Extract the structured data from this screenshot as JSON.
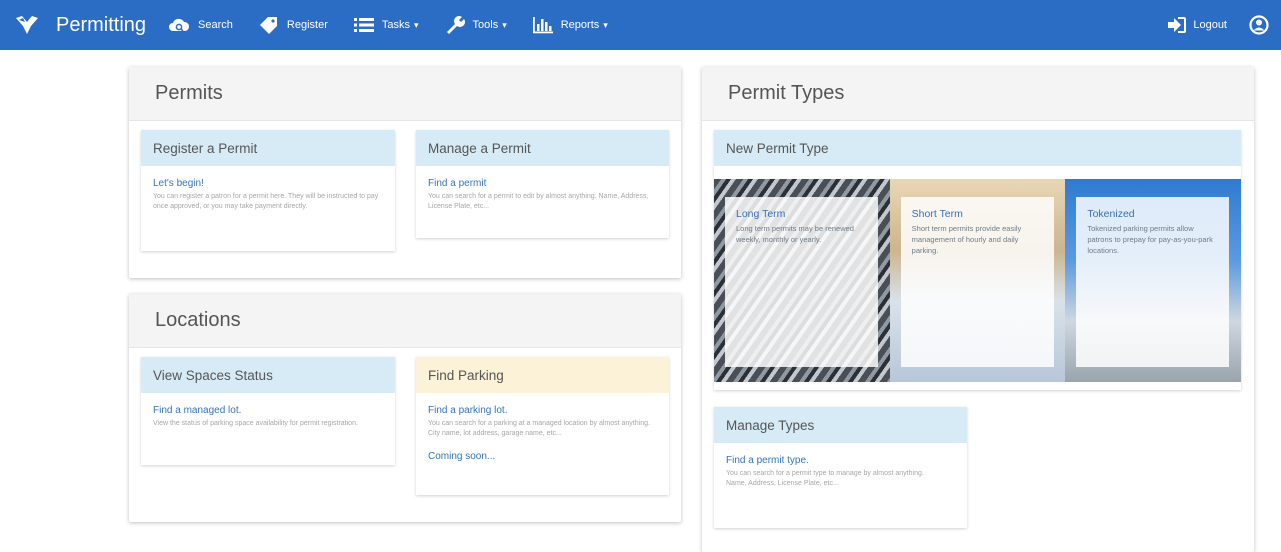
{
  "navbar": {
    "brand": "Permitting",
    "logout": "Logout",
    "items": [
      {
        "label": "Search",
        "icon": "search-cloud-icon",
        "caret": false
      },
      {
        "label": "Register",
        "icon": "tag-icon",
        "caret": false
      },
      {
        "label": "Tasks",
        "icon": "list-icon",
        "caret": true
      },
      {
        "label": "Tools",
        "icon": "wrench-icon",
        "caret": true
      },
      {
        "label": "Reports",
        "icon": "bar-chart-icon",
        "caret": true
      }
    ]
  },
  "permits": {
    "title": "Permits",
    "register": {
      "heading": "Register a Permit",
      "link": "Let's begin!",
      "text": "You can register a patron for a permit here. They will be instructed to pay once approved, or you may take payment directly."
    },
    "manage": {
      "heading": "Manage a Permit",
      "link": "Find a permit",
      "text": "You can search for a permit to edit by almost anything. Name, Address, License Plate, etc..."
    }
  },
  "locations": {
    "title": "Locations",
    "view": {
      "heading": "View Spaces Status",
      "link": "Find a managed lot.",
      "text": "View the status of parking space availability for permit registration."
    },
    "find": {
      "heading": "Find Parking",
      "link": "Find a parking lot.",
      "text": "You can search for a parking at a managed location by almost anything.",
      "text2": "City name, lot address, garage name, etc...",
      "soon": "Coming soon..."
    }
  },
  "permit_types": {
    "title": "Permit Types",
    "new_heading": "New Permit Type",
    "types": [
      {
        "title": "Long Term",
        "text": "Long term permits may be renewed weekly, monthly or yearly."
      },
      {
        "title": "Short Term",
        "text": "Short term permits provide easily management of hourly and daily parking."
      },
      {
        "title": "Tokenized",
        "text": "Tokenized parking permits allow patrons to prepay for pay-as-you-park locations."
      }
    ],
    "manage": {
      "heading": "Manage Types",
      "link": "Find a permit type.",
      "text": "You can search for a permit type to manage by almost anything.",
      "text2": "Name, Address, License Plate, etc..."
    }
  },
  "colors": {
    "navbar": "#2b6cc4",
    "card_head_blue": "#d7ebf7",
    "card_head_yellow": "#fbf2d8",
    "link": "#3374b9"
  }
}
